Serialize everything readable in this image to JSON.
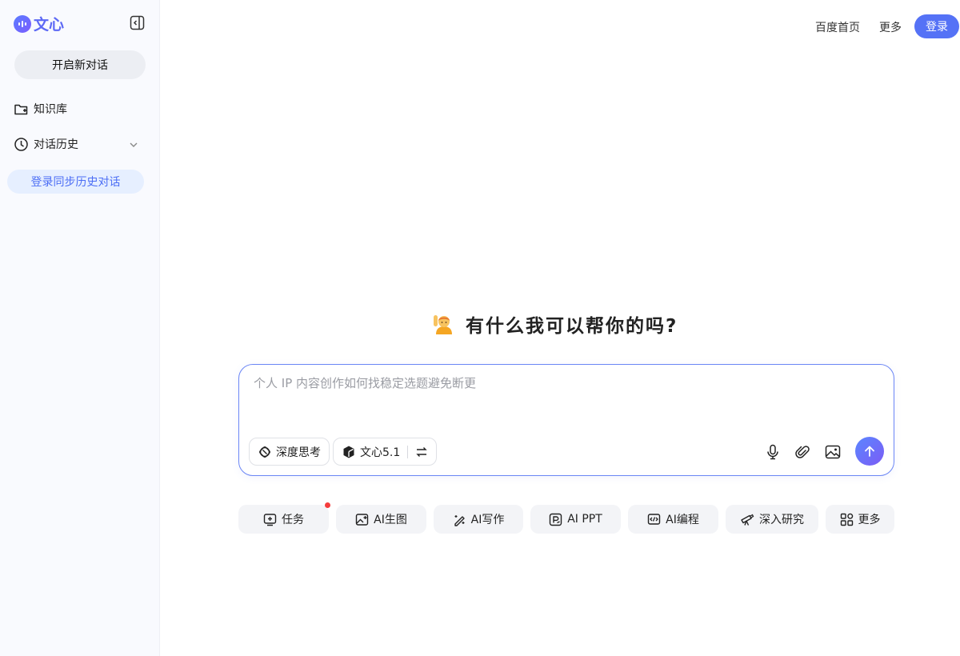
{
  "brand": {
    "logo_text": "文心",
    "accent": "#5572f6"
  },
  "sidebar": {
    "new_chat_label": "开启新对话",
    "items": [
      {
        "label": "知识库",
        "icon": "folder-icon"
      },
      {
        "label": "对话历史",
        "icon": "clock-icon"
      }
    ],
    "login_sync_label": "登录同步历史对话"
  },
  "topnav": {
    "home_label": "百度首页",
    "more_label": "更多",
    "login_label": "登录"
  },
  "main": {
    "greeting": "有什么我可以帮你的吗?",
    "composer": {
      "placeholder": "个人 IP 内容创作如何找稳定选题避免断更",
      "value": "",
      "deep_think_label": "深度思考",
      "model_label": "文心5.1"
    },
    "quick_actions": [
      {
        "label": "任务",
        "icon": "task-icon",
        "badge": true
      },
      {
        "label": "AI生图",
        "icon": "image-gen-icon"
      },
      {
        "label": "AI写作",
        "icon": "pen-icon"
      },
      {
        "label": "AI PPT",
        "icon": "ppt-icon"
      },
      {
        "label": "AI编程",
        "icon": "code-icon"
      },
      {
        "label": "深入研究",
        "icon": "telescope-icon"
      },
      {
        "label": "更多",
        "icon": "grid-icon"
      }
    ]
  }
}
